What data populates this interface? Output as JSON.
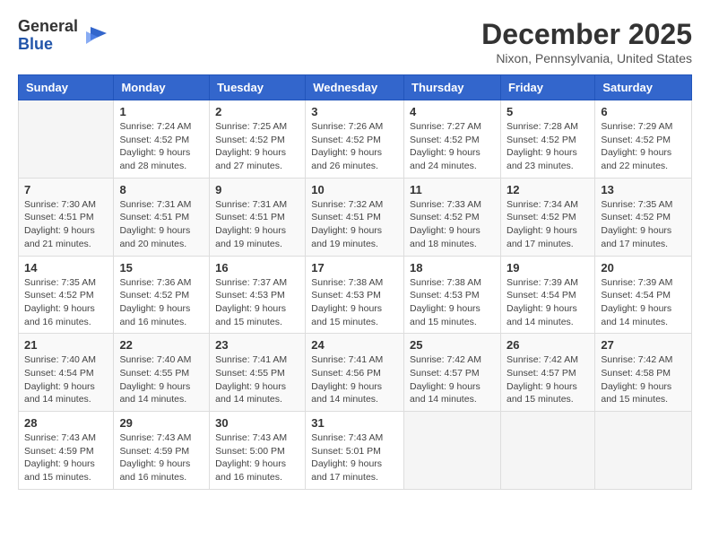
{
  "logo": {
    "general": "General",
    "blue": "Blue"
  },
  "title": "December 2025",
  "location": "Nixon, Pennsylvania, United States",
  "days_of_week": [
    "Sunday",
    "Monday",
    "Tuesday",
    "Wednesday",
    "Thursday",
    "Friday",
    "Saturday"
  ],
  "weeks": [
    [
      {
        "day": "",
        "sunrise": "",
        "sunset": "",
        "daylight": ""
      },
      {
        "day": "1",
        "sunrise": "Sunrise: 7:24 AM",
        "sunset": "Sunset: 4:52 PM",
        "daylight": "Daylight: 9 hours and 28 minutes."
      },
      {
        "day": "2",
        "sunrise": "Sunrise: 7:25 AM",
        "sunset": "Sunset: 4:52 PM",
        "daylight": "Daylight: 9 hours and 27 minutes."
      },
      {
        "day": "3",
        "sunrise": "Sunrise: 7:26 AM",
        "sunset": "Sunset: 4:52 PM",
        "daylight": "Daylight: 9 hours and 26 minutes."
      },
      {
        "day": "4",
        "sunrise": "Sunrise: 7:27 AM",
        "sunset": "Sunset: 4:52 PM",
        "daylight": "Daylight: 9 hours and 24 minutes."
      },
      {
        "day": "5",
        "sunrise": "Sunrise: 7:28 AM",
        "sunset": "Sunset: 4:52 PM",
        "daylight": "Daylight: 9 hours and 23 minutes."
      },
      {
        "day": "6",
        "sunrise": "Sunrise: 7:29 AM",
        "sunset": "Sunset: 4:52 PM",
        "daylight": "Daylight: 9 hours and 22 minutes."
      }
    ],
    [
      {
        "day": "7",
        "sunrise": "Sunrise: 7:30 AM",
        "sunset": "Sunset: 4:51 PM",
        "daylight": "Daylight: 9 hours and 21 minutes."
      },
      {
        "day": "8",
        "sunrise": "Sunrise: 7:31 AM",
        "sunset": "Sunset: 4:51 PM",
        "daylight": "Daylight: 9 hours and 20 minutes."
      },
      {
        "day": "9",
        "sunrise": "Sunrise: 7:31 AM",
        "sunset": "Sunset: 4:51 PM",
        "daylight": "Daylight: 9 hours and 19 minutes."
      },
      {
        "day": "10",
        "sunrise": "Sunrise: 7:32 AM",
        "sunset": "Sunset: 4:51 PM",
        "daylight": "Daylight: 9 hours and 19 minutes."
      },
      {
        "day": "11",
        "sunrise": "Sunrise: 7:33 AM",
        "sunset": "Sunset: 4:52 PM",
        "daylight": "Daylight: 9 hours and 18 minutes."
      },
      {
        "day": "12",
        "sunrise": "Sunrise: 7:34 AM",
        "sunset": "Sunset: 4:52 PM",
        "daylight": "Daylight: 9 hours and 17 minutes."
      },
      {
        "day": "13",
        "sunrise": "Sunrise: 7:35 AM",
        "sunset": "Sunset: 4:52 PM",
        "daylight": "Daylight: 9 hours and 17 minutes."
      }
    ],
    [
      {
        "day": "14",
        "sunrise": "Sunrise: 7:35 AM",
        "sunset": "Sunset: 4:52 PM",
        "daylight": "Daylight: 9 hours and 16 minutes."
      },
      {
        "day": "15",
        "sunrise": "Sunrise: 7:36 AM",
        "sunset": "Sunset: 4:52 PM",
        "daylight": "Daylight: 9 hours and 16 minutes."
      },
      {
        "day": "16",
        "sunrise": "Sunrise: 7:37 AM",
        "sunset": "Sunset: 4:53 PM",
        "daylight": "Daylight: 9 hours and 15 minutes."
      },
      {
        "day": "17",
        "sunrise": "Sunrise: 7:38 AM",
        "sunset": "Sunset: 4:53 PM",
        "daylight": "Daylight: 9 hours and 15 minutes."
      },
      {
        "day": "18",
        "sunrise": "Sunrise: 7:38 AM",
        "sunset": "Sunset: 4:53 PM",
        "daylight": "Daylight: 9 hours and 15 minutes."
      },
      {
        "day": "19",
        "sunrise": "Sunrise: 7:39 AM",
        "sunset": "Sunset: 4:54 PM",
        "daylight": "Daylight: 9 hours and 14 minutes."
      },
      {
        "day": "20",
        "sunrise": "Sunrise: 7:39 AM",
        "sunset": "Sunset: 4:54 PM",
        "daylight": "Daylight: 9 hours and 14 minutes."
      }
    ],
    [
      {
        "day": "21",
        "sunrise": "Sunrise: 7:40 AM",
        "sunset": "Sunset: 4:54 PM",
        "daylight": "Daylight: 9 hours and 14 minutes."
      },
      {
        "day": "22",
        "sunrise": "Sunrise: 7:40 AM",
        "sunset": "Sunset: 4:55 PM",
        "daylight": "Daylight: 9 hours and 14 minutes."
      },
      {
        "day": "23",
        "sunrise": "Sunrise: 7:41 AM",
        "sunset": "Sunset: 4:55 PM",
        "daylight": "Daylight: 9 hours and 14 minutes."
      },
      {
        "day": "24",
        "sunrise": "Sunrise: 7:41 AM",
        "sunset": "Sunset: 4:56 PM",
        "daylight": "Daylight: 9 hours and 14 minutes."
      },
      {
        "day": "25",
        "sunrise": "Sunrise: 7:42 AM",
        "sunset": "Sunset: 4:57 PM",
        "daylight": "Daylight: 9 hours and 14 minutes."
      },
      {
        "day": "26",
        "sunrise": "Sunrise: 7:42 AM",
        "sunset": "Sunset: 4:57 PM",
        "daylight": "Daylight: 9 hours and 15 minutes."
      },
      {
        "day": "27",
        "sunrise": "Sunrise: 7:42 AM",
        "sunset": "Sunset: 4:58 PM",
        "daylight": "Daylight: 9 hours and 15 minutes."
      }
    ],
    [
      {
        "day": "28",
        "sunrise": "Sunrise: 7:43 AM",
        "sunset": "Sunset: 4:59 PM",
        "daylight": "Daylight: 9 hours and 15 minutes."
      },
      {
        "day": "29",
        "sunrise": "Sunrise: 7:43 AM",
        "sunset": "Sunset: 4:59 PM",
        "daylight": "Daylight: 9 hours and 16 minutes."
      },
      {
        "day": "30",
        "sunrise": "Sunrise: 7:43 AM",
        "sunset": "Sunset: 5:00 PM",
        "daylight": "Daylight: 9 hours and 16 minutes."
      },
      {
        "day": "31",
        "sunrise": "Sunrise: 7:43 AM",
        "sunset": "Sunset: 5:01 PM",
        "daylight": "Daylight: 9 hours and 17 minutes."
      },
      {
        "day": "",
        "sunrise": "",
        "sunset": "",
        "daylight": ""
      },
      {
        "day": "",
        "sunrise": "",
        "sunset": "",
        "daylight": ""
      },
      {
        "day": "",
        "sunrise": "",
        "sunset": "",
        "daylight": ""
      }
    ]
  ]
}
